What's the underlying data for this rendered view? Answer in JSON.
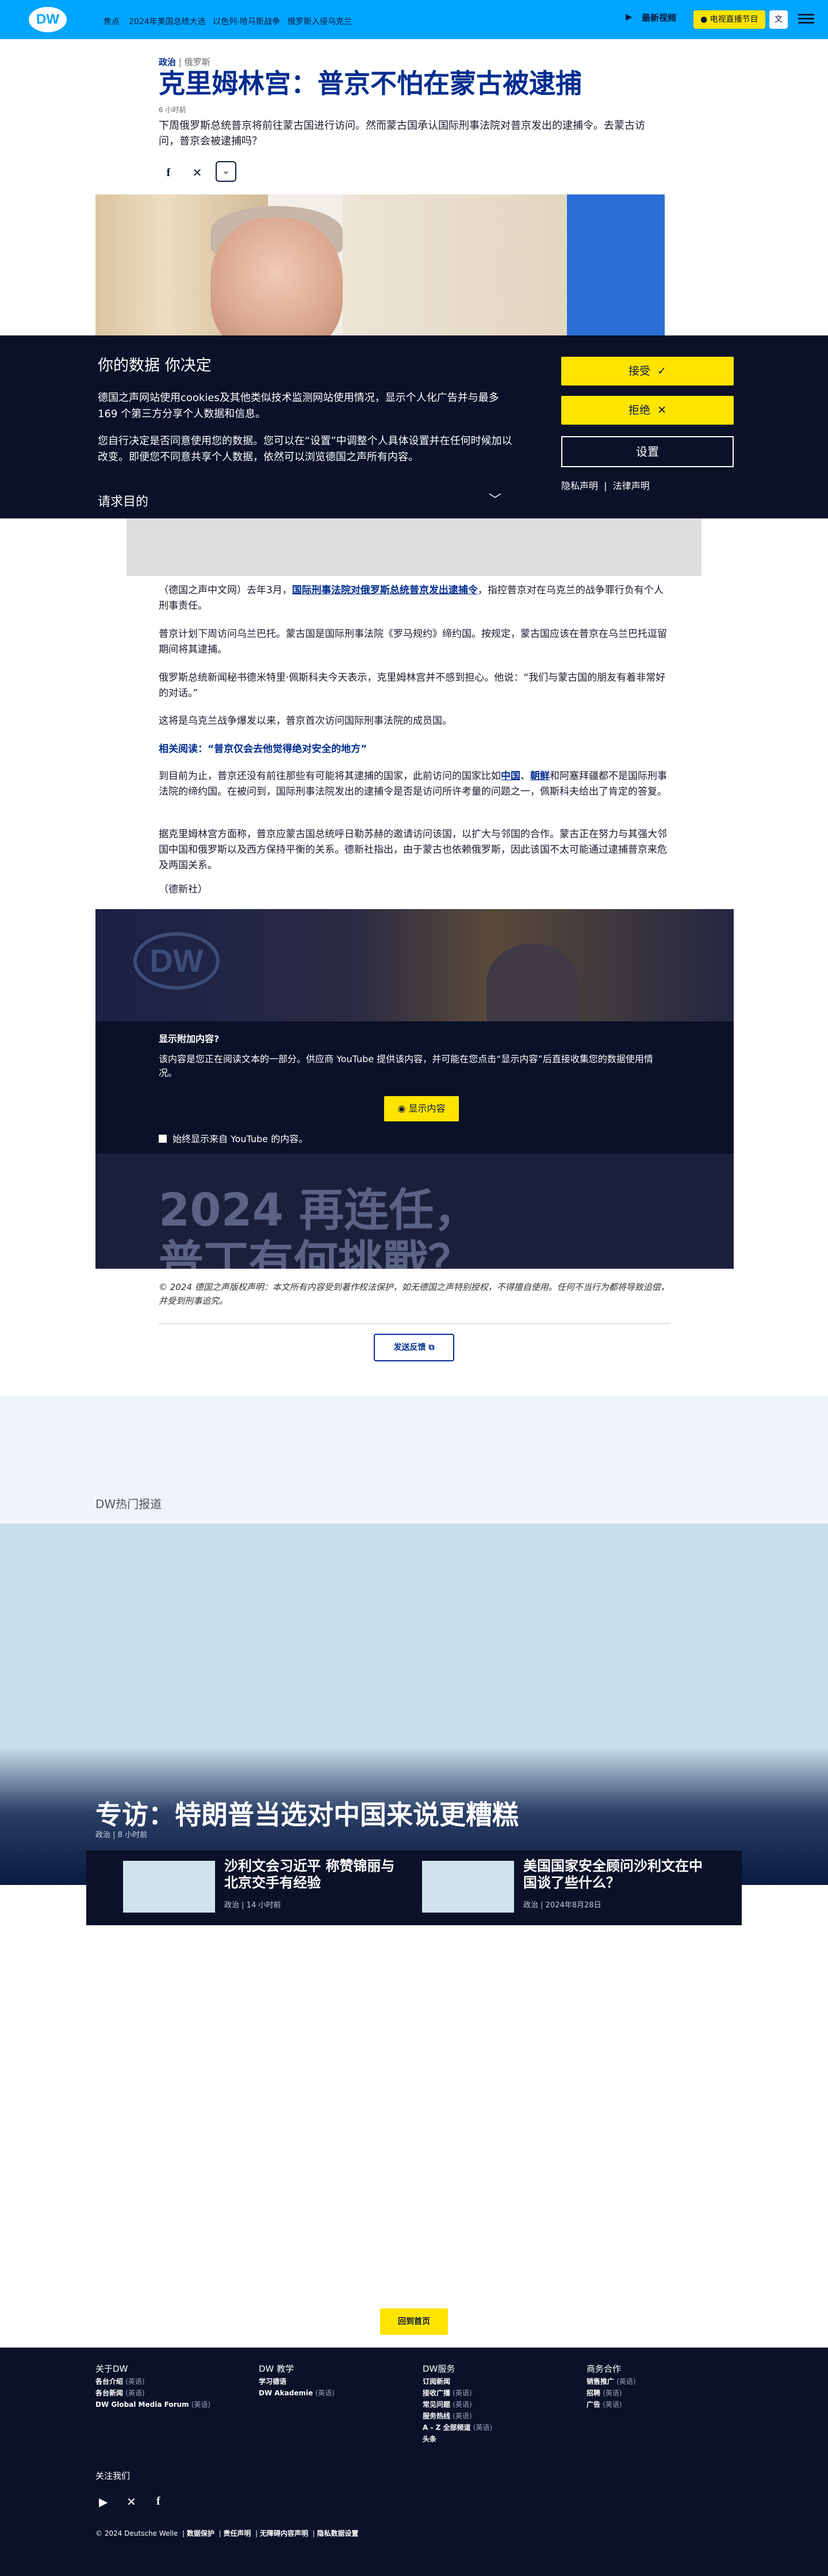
{
  "nav": {
    "logo": "DW",
    "hot_label": "焦点",
    "links": [
      "2024年美国总统大选",
      "以色列-哈马斯战争",
      "俄罗斯入侵乌克兰"
    ],
    "latest_video": "最新视频",
    "live_tv": "电视直播节目",
    "language": "文"
  },
  "article": {
    "category": "政治",
    "subcategory": "俄罗斯",
    "title": "克里姆林宫：普京不怕在蒙古被逮捕",
    "timestamp": "6 小时前",
    "teaser": "下周俄罗斯总统普京将前往蒙古国进行访问。然而蒙古国承认国际刑事法院对普京发出的逮捕令。去蒙古访问，普京会被逮捕吗？",
    "paragraphs": [
      {
        "pre": "（德国之声中文网）去年3月，",
        "link": "国际刑事法院对俄罗斯总统普京发出逮捕令",
        "post": "，指控普京对在乌克兰的战争罪行负有个人刑事责任。"
      },
      {
        "pre": "普京计划下周访问乌兰巴托。蒙古国是国际刑事法院《罗马规约》缔约国。按规定，蒙古国应该在普京在乌兰巴托逗留期间将其逮捕。",
        "link": "",
        "post": ""
      },
      {
        "pre": "俄罗斯总统新闻秘书德米特里·佩斯科夫今天表示，克里姆林宫并不感到担心。他说：“我们与蒙古国的朋友有着非常好的对话。”",
        "link": "",
        "post": ""
      },
      {
        "pre": "这将是乌克兰战争爆发以来，普京首次访问国际刑事法院的成员国。",
        "link": "",
        "post": ""
      }
    ],
    "related": "相关阅读：“普京仅会去他觉得绝对安全的地方”",
    "paragraph_after": {
      "pre": "到目前为止，普京还没有前往那些有可能将其逮捕的国家，此前访问的国家比如",
      "link1": "中国",
      "mid": "、",
      "link2": "朝鲜",
      "post": "和阿塞拜疆都不是国际刑事法院的缔约国。在被问到，国际刑事法院发出的逮捕令是否是访问所许考量的问题之一，佩斯科夫给出了肯定的答复。"
    },
    "paragraph_last": "据克里姆林宫方面称，普京应蒙古国总统呼日勒苏赫的邀请访问该国，以扩大与邻国的合作。蒙古正在努力与其强大邻国中国和俄罗斯以及西方保持平衡的关系。德新社指出，由于蒙古也依赖俄罗斯，因此该国不太可能通过逮捕普京来危及两国关系。",
    "source": "（德新社）",
    "copyright": "© 2024 德国之声版权声明：本文所有内容受到著作权法保护，如无德国之声特别授权，不得擅自使用。任何不当行为都将导致追偿，并受到刑事追究。",
    "feedback": "发送反馈"
  },
  "consent": {
    "title": "你的数据 你决定",
    "p1": "德国之声网站使用cookies及其他类似技术监测网站使用情况，显示个人化广告并与最多169 个第三方分享个人数据和信息。",
    "p2": "您自行决定是否同意使用您的数据。您可以在“设置”中调整个人具体设置并在任何时候加以改变。即便您不同意共享个人数据，依然可以浏览德国之声所有内容。",
    "purpose": "请求目的",
    "accept": "接受",
    "reject": "拒绝",
    "settings": "设置",
    "privacy": "隐私声明",
    "legal": "法律声明"
  },
  "video": {
    "logo": "DW",
    "overlay_text_1": "2024 再连任，",
    "overlay_text_2": "普丁有何挑戰？",
    "heading": "显示附加内容?",
    "description": "该内容是您正在阅读文本的一部分。供应商 YouTube 提供该内容，并可能在您点击“显示内容”后直接收集您的数据使用情况。",
    "show_button": "显示内容",
    "always_show": "始终显示来自 YouTube 的内容。"
  },
  "popular": {
    "label": "DW热门报道",
    "feature_title": "专访：特朗普当选对中国来说更糟糕",
    "feature_category": "政治",
    "feature_time": "8 小时前",
    "teasers": [
      {
        "title": "沙利文会习近平 称赞锦丽与北京交手有经验",
        "category": "政治",
        "time": "14 小时前"
      },
      {
        "title": "美国国家安全顾问沙利文在中国谈了些什么？",
        "category": "政治",
        "time": "2024年8月28日"
      }
    ],
    "back_to_top": "回到首页"
  },
  "footer": {
    "columns": [
      {
        "heading": "关于DW",
        "items": [
          {
            "label": "各台介绍",
            "tag": "(英语)"
          },
          {
            "label": "各台新闻",
            "tag": "(英语)"
          },
          {
            "label": "DW Global Media Forum",
            "tag": "(英语)"
          }
        ]
      },
      {
        "heading": "DW 教学",
        "items": [
          {
            "label": "学习德语",
            "tag": ""
          },
          {
            "label": "DW Akademie",
            "tag": "(英语)"
          }
        ]
      },
      {
        "heading": "DW服务",
        "items": [
          {
            "label": "订阅新闻",
            "tag": ""
          },
          {
            "label": "接收广播",
            "tag": "(英语)"
          },
          {
            "label": "常见问题",
            "tag": "(英语)"
          },
          {
            "label": "服务热线",
            "tag": "(英语)"
          },
          {
            "label": "A - Z 全部频道",
            "tag": "(英语)"
          },
          {
            "label": "头条",
            "tag": ""
          }
        ]
      },
      {
        "heading": "商务合作",
        "items": [
          {
            "label": "销售推广",
            "tag": "(英语)"
          },
          {
            "label": "招聘",
            "tag": "(英语)"
          },
          {
            "label": "广告",
            "tag": "(英语)"
          }
        ]
      }
    ],
    "follow": "关注我们",
    "copyright": "© 2024 Deutsche Welle",
    "legal_links": [
      "数据保护",
      "责任声明",
      "无障碍内容声明",
      "隐私数据设置"
    ]
  }
}
